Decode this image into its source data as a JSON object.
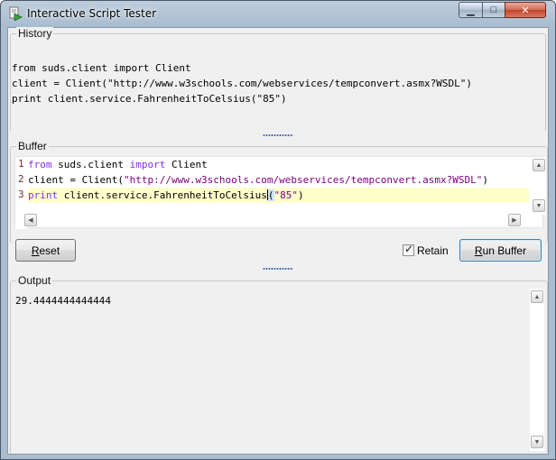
{
  "window": {
    "title": "Interactive Script Tester",
    "min_glyph": "▁",
    "max_glyph": "□",
    "close_glyph": "✕"
  },
  "history": {
    "label": "History",
    "lines": [
      "from suds.client import Client",
      "client = Client(\"http://www.w3schools.com/webservices/tempconvert.asmx?WSDL\")",
      "print client.service.FahrenheitToCelsius(\"85\")"
    ]
  },
  "buffer": {
    "label": "Buffer",
    "line_numbers": [
      "1",
      "2",
      "3"
    ],
    "line1": {
      "kw_from": "from",
      "module": " suds.client ",
      "kw_import": "import",
      "name": " Client"
    },
    "line2": {
      "prefix": "client = Client(",
      "string": "\"http://www.w3schools.com/webservices/tempconvert.asmx?WSDL\"",
      "suffix": ")"
    },
    "line3": {
      "kw_print": "print",
      "call": " client.service.FahrenheitToCelsius",
      "paren": "(",
      "string": "\"85\"",
      "suffix": ")"
    }
  },
  "controls": {
    "reset_mnemonic": "R",
    "reset_rest": "eset",
    "retain_label": "Retain",
    "retain_checked": true,
    "run_mnemonic": "R",
    "run_rest": "un Buffer"
  },
  "output": {
    "label": "Output",
    "text": "29.4444444444444"
  },
  "colors": {
    "keyword": "#8a2be2",
    "string": "#7f0080",
    "current_line": "#ffffcc"
  }
}
